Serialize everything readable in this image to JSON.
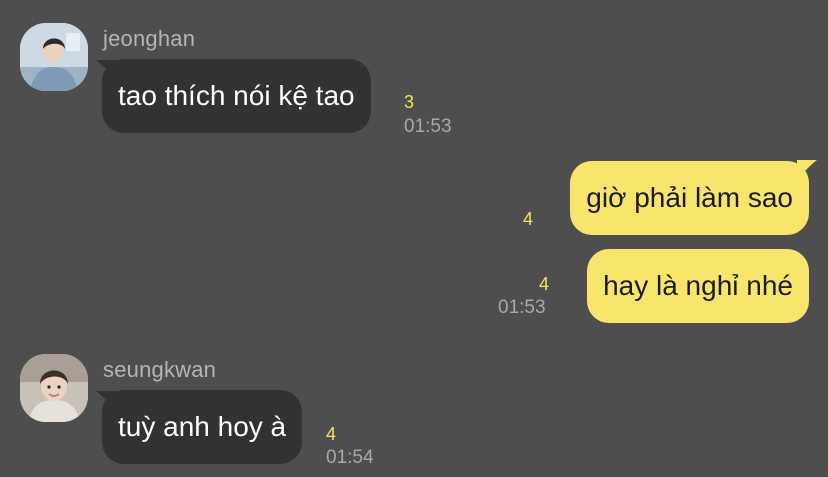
{
  "messages": [
    {
      "sender": "jeonghan",
      "text": "tao thích nói kệ tao",
      "unread": "3",
      "time": "01:53"
    },
    {
      "text": "giờ phải làm sao",
      "unread": "4"
    },
    {
      "text": "hay là nghỉ nhé",
      "unread": "4",
      "time": "01:53"
    },
    {
      "sender": "seungkwan",
      "text": "tuỳ anh hoy à",
      "unread": "4",
      "time": "01:54"
    }
  ],
  "colors": {
    "background": "#4f4e4f",
    "incoming_bubble": "#333233",
    "outgoing_bubble": "#f8e56b",
    "unread_count": "#f2e35a"
  }
}
